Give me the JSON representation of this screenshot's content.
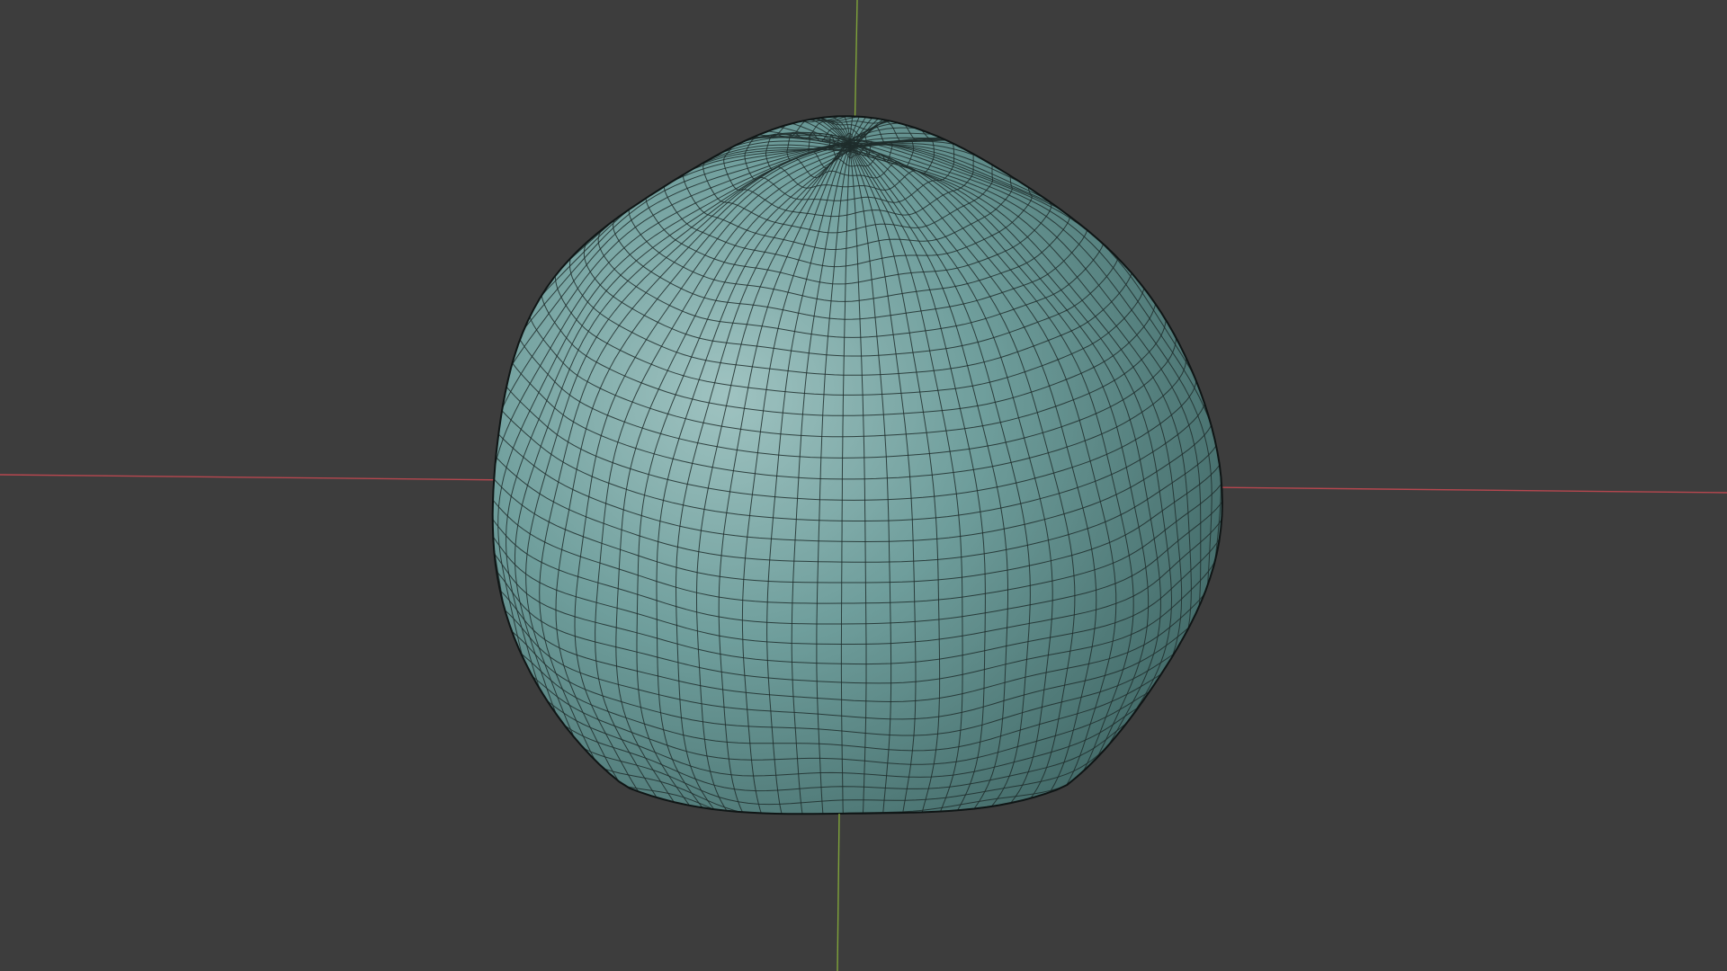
{
  "viewport": {
    "background_color": "#3d3d3d",
    "x_axis_color": "#b7474f",
    "y_axis_color": "#7fa33a",
    "mesh_fill_color": "#6f9e9c",
    "mesh_highlight_color": "#9fc3c1",
    "mesh_shadow_color": "#3f6664",
    "wire_color": "#1e2d2c",
    "outline_color": "#0f1515"
  },
  "scene": {
    "object": "sculpted-sphere-mesh",
    "shading": "solid",
    "overlays": [
      "x-axis-line",
      "y-axis-line",
      "wireframe"
    ]
  }
}
